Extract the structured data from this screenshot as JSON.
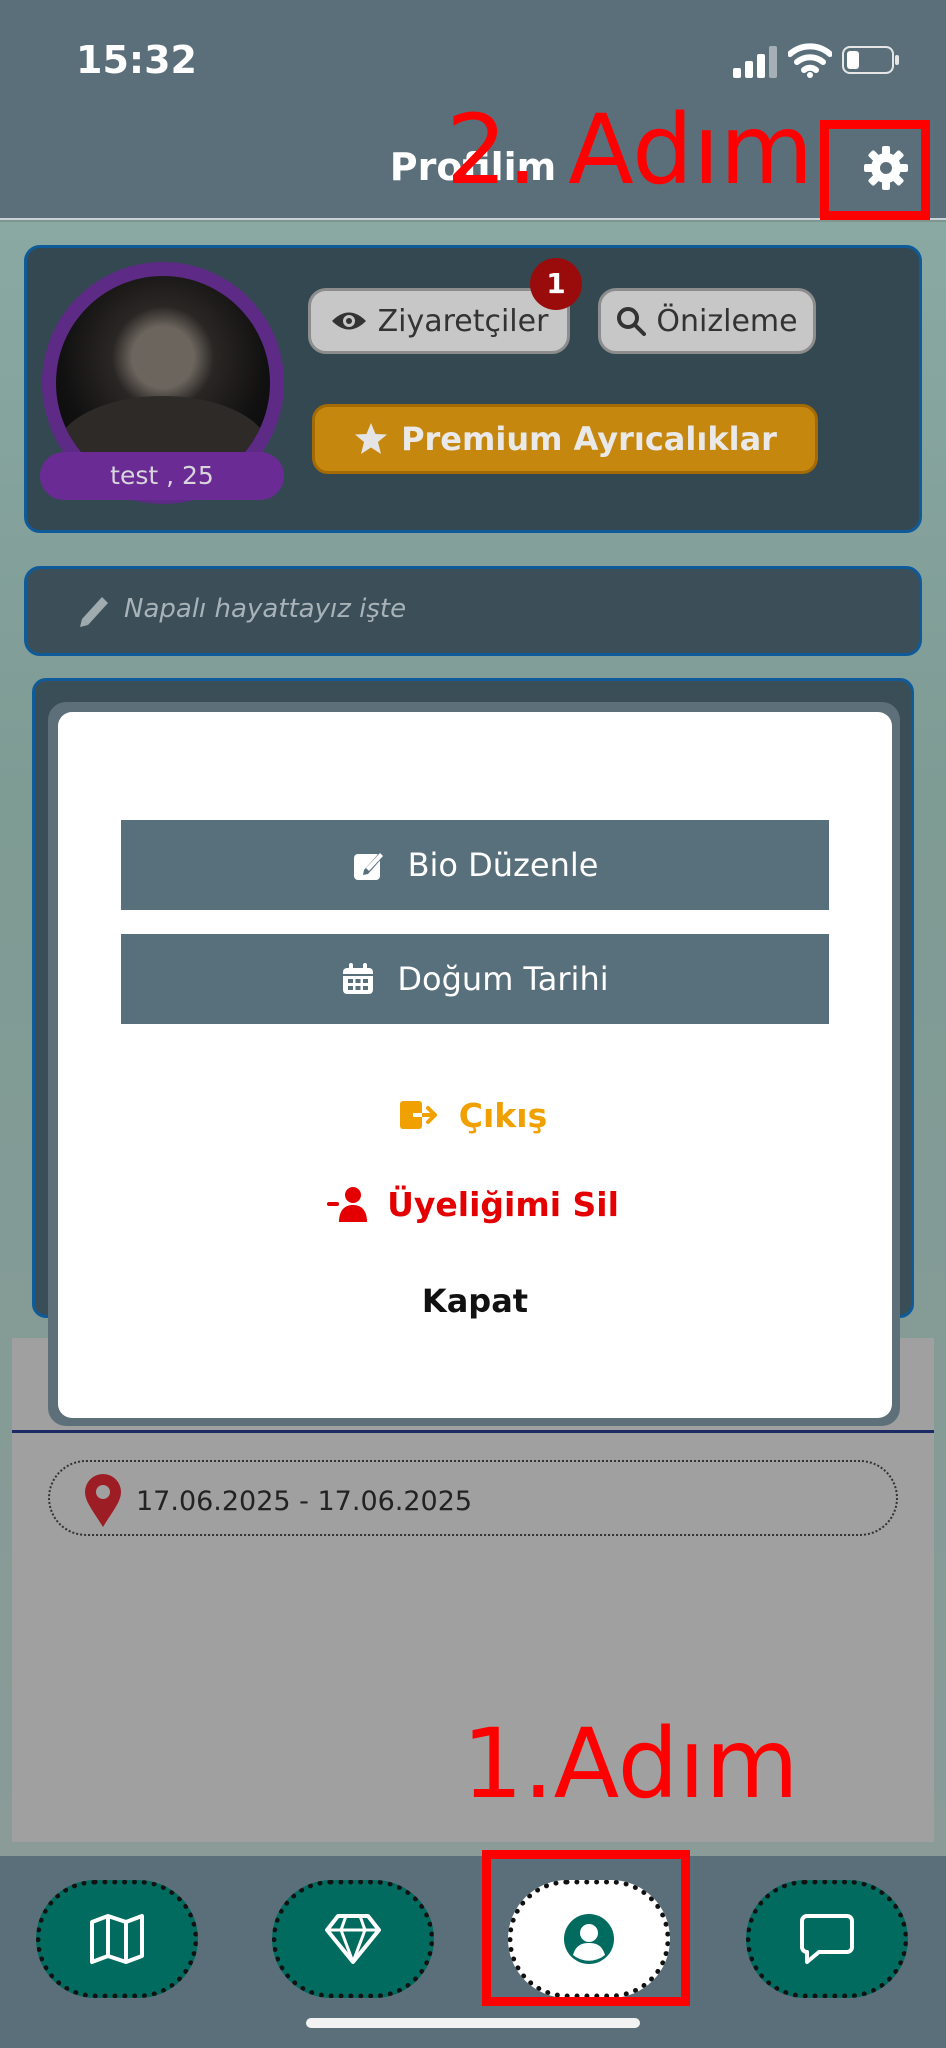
{
  "status_bar": {
    "time": "15:32"
  },
  "header": {
    "title": "Profilim",
    "settings_icon": "gear-icon"
  },
  "profile": {
    "name_age": "test , 25",
    "visitors_label": "Ziyaretçiler",
    "visitors_badge": "1",
    "preview_label": "Önizleme",
    "premium_label": "Premium Ayrıcalıklar"
  },
  "bio": {
    "text": "Napalı hayattayız işte"
  },
  "date_range": "17.06.2025 - 17.06.2025",
  "modal": {
    "bio_edit": "Bio Düzenle",
    "birthday": "Doğum Tarihi",
    "logout": "Çıkış",
    "delete_account": "Üyeliğimi Sil",
    "close": "Kapat"
  },
  "tabs": [
    {
      "name": "map",
      "icon": "map-icon"
    },
    {
      "name": "premium",
      "icon": "diamond-icon"
    },
    {
      "name": "profile",
      "icon": "user-circle-icon",
      "active": true
    },
    {
      "name": "chat",
      "icon": "chat-icon"
    }
  ],
  "annotations": {
    "step2": "2. Adım",
    "step1": "1.Adım"
  },
  "colors": {
    "header": "#5b6f7b",
    "modal_button": "#586f7c",
    "logout": "#f0a000",
    "delete": "#e40000",
    "premium": "#c6870e",
    "tab": "#006b5e",
    "annotation": "#ff0000"
  }
}
